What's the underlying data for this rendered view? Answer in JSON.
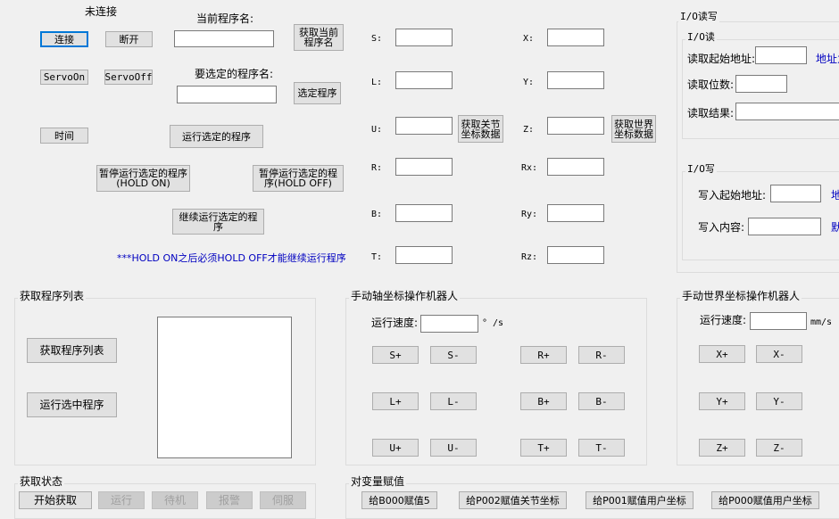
{
  "conn": {
    "status": "未连接",
    "connect": "连接",
    "disconnect": "断开",
    "servo_on": "ServoOn",
    "servo_off": "ServoOff",
    "time": "时间"
  },
  "program": {
    "current_label": "当前程序名:",
    "get_current": "获取当前程序名",
    "select_label": "要选定的程序名:",
    "select_btn": "选定程序",
    "run_selected": "运行选定的程序",
    "pause_on": "暂停运行选定的程序(HOLD ON)",
    "pause_off": "暂停运行选定的程序(HOLD OFF)",
    "continue": "继续运行选定的程序",
    "hold_note": "***HOLD ON之后必须HOLD OFF才能继续运行程序"
  },
  "coords": {
    "s": "S:",
    "l": "L:",
    "u": "U:",
    "r": "R:",
    "b": "B:",
    "t": "T:",
    "x": "X:",
    "y": "Y:",
    "z": "Z:",
    "rx": "Rx:",
    "ry": "Ry:",
    "rz": "Rz:",
    "get_joint": "获取关节坐标数据",
    "get_world": "获取世界坐标数据"
  },
  "io": {
    "title": "I/O读写",
    "read_title": "I/O读",
    "read_start": "读取起始地址:",
    "addr_hint_read": "地址为",
    "read_count": "读取位数:",
    "read_result": "读取结果:",
    "write_title": "I/O写",
    "write_start": "写入起始地址:",
    "addr_hint_write": "地",
    "write_content": "写入内容:",
    "write_hint": "默"
  },
  "prog_list": {
    "title": "获取程序列表",
    "get_list": "获取程序列表",
    "run_selected": "运行选中程序"
  },
  "manual_axis": {
    "title": "手动轴坐标操作机器人",
    "speed_label": "运行速度:",
    "speed_unit": "° /s",
    "buttons": [
      "S+",
      "S-",
      "R+",
      "R-",
      "L+",
      "L-",
      "B+",
      "B-",
      "U+",
      "U-",
      "T+",
      "T-"
    ]
  },
  "manual_world": {
    "title": "手动世界坐标操作机器人",
    "speed_label": "运行速度:",
    "speed_unit": "mm/s",
    "buttons": [
      "X+",
      "X-",
      "Y+",
      "Y-",
      "Z+",
      "Z-"
    ]
  },
  "status": {
    "title": "获取状态",
    "start": "开始获取",
    "run": "运行",
    "standby": "待机",
    "alarm": "报警",
    "servo": "伺服"
  },
  "vars": {
    "title": "对变量赋值",
    "b000": "给B000赋值5",
    "p002": "给P002赋值关节坐标",
    "p001": "给P001赋值用户坐标",
    "p000": "给P000赋值用户坐标"
  }
}
